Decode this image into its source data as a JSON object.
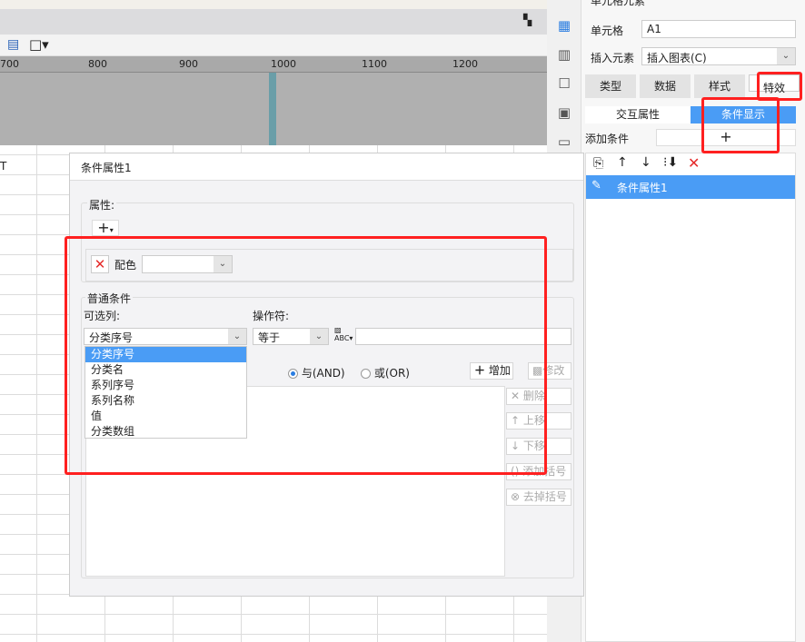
{
  "ruler": {
    "ticks": [
      "700",
      "800",
      "900",
      "1000",
      "1100",
      "1200"
    ]
  },
  "sheet": {
    "col_header_fragment": "T"
  },
  "panel": {
    "header": "单元格元素",
    "cell_label": "单元格",
    "cell_value": "A1",
    "insert_label": "插入元素",
    "insert_value": "插入图表(C)",
    "tabs": [
      {
        "label": "类型"
      },
      {
        "label": "数据"
      },
      {
        "label": "样式"
      },
      {
        "label": "特效",
        "selected": true
      }
    ],
    "subtabs": [
      {
        "label": "交互属性"
      },
      {
        "label": "条件显示",
        "selected": true
      }
    ],
    "add_condition_label": "添加条件",
    "add_symbol": "+",
    "list": [
      {
        "label": "条件属性1",
        "selected": true
      }
    ]
  },
  "dialog": {
    "title": "条件属性1",
    "attr_label": "属性:",
    "add_symbol": "+",
    "color_label": "配色",
    "normal_cond_label": "普通条件",
    "column_label": "可选列:",
    "column_value": "分类序号",
    "operator_label": "操作符:",
    "operator_value": "等于",
    "value_input": "",
    "column_options": [
      "分类序号",
      "分类名",
      "系列序号",
      "系列名称",
      "值",
      "分类数组"
    ],
    "and_label": "与(AND)",
    "or_label": "或(OR)",
    "logic_selected": "AND",
    "buttons": {
      "add": "增加",
      "modify": "修改",
      "delete": "删除",
      "up": "上移",
      "down": "下移",
      "add_bracket": "添加括号",
      "remove_bracket": "去掉括号"
    }
  },
  "colors": {
    "accent": "#4a9cf5",
    "highlight_box": "#ff2020"
  }
}
